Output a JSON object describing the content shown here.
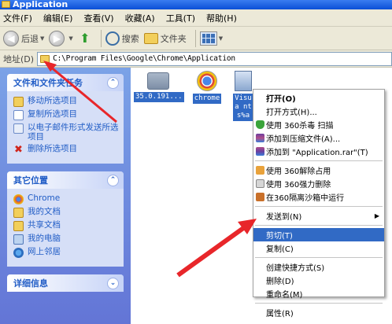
{
  "window": {
    "title": "Application"
  },
  "menubar": {
    "items": [
      "文件(F)",
      "编辑(E)",
      "查看(V)",
      "收藏(A)",
      "工具(T)",
      "帮助(H)"
    ]
  },
  "toolbar": {
    "back_label": "后退",
    "search_label": "搜索",
    "folders_label": "文件夹"
  },
  "address": {
    "label": "地址(D)",
    "path": "C:\\Program Files\\Google\\Chrome\\Application"
  },
  "tasks_panel": {
    "title": "文件和文件夹任务",
    "items": [
      "移动所选项目",
      "复制所选项目",
      "以电子邮件形式发送所选项目",
      "删除所选项目"
    ]
  },
  "places_panel": {
    "title": "其它位置",
    "items": [
      "Chrome",
      "我的文档",
      "共享文档",
      "我的电脑",
      "网上邻居"
    ]
  },
  "details_panel": {
    "title": "详细信息"
  },
  "files": [
    {
      "name": "35.0.191...",
      "icon": "folder-icon"
    },
    {
      "name": "chrome",
      "icon": "chrome-icon"
    },
    {
      "name": "Visua nts%a",
      "icon": "vbs-file-icon"
    }
  ],
  "context_menu": {
    "items": [
      {
        "label": "打开(O)",
        "bold": true,
        "icon": ""
      },
      {
        "label": "打开方式(H)...",
        "icon": ""
      },
      {
        "label": "使用 360杀毒 扫描",
        "icon": "shield-icon"
      },
      {
        "label": "添加到压缩文件(A)...",
        "icon": "winrar-icon"
      },
      {
        "label": "添加到 \"Application.rar\"(T)",
        "icon": "winrar-icon"
      },
      {
        "sep": true
      },
      {
        "label": "使用 360解除占用",
        "icon": "unlock-icon"
      },
      {
        "label": "使用 360强力删除",
        "icon": "force-delete-icon"
      },
      {
        "label": "在360隔离沙箱中运行",
        "icon": "sandbox-icon"
      },
      {
        "sep": true
      },
      {
        "label": "发送到(N)",
        "submenu": true,
        "icon": ""
      },
      {
        "sep": true
      },
      {
        "label": "剪切(T)",
        "highlighted": true,
        "icon": ""
      },
      {
        "label": "复制(C)",
        "icon": ""
      },
      {
        "sep": true
      },
      {
        "label": "创建快捷方式(S)",
        "icon": ""
      },
      {
        "label": "删除(D)",
        "icon": ""
      },
      {
        "label": "重命名(M)",
        "icon": ""
      },
      {
        "sep": true
      },
      {
        "label": "属性(R)",
        "icon": ""
      }
    ]
  },
  "colors": {
    "arrow": "#e8262a",
    "highlight": "#316ac5",
    "task_link": "#215dc6"
  }
}
